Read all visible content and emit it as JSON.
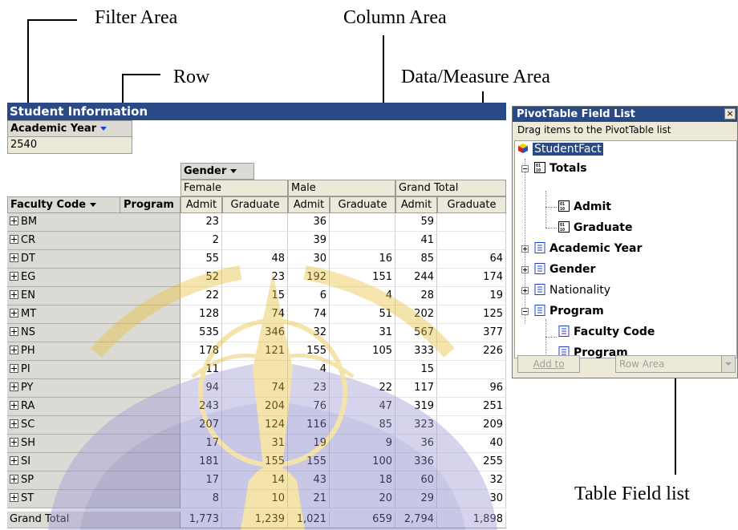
{
  "callouts": {
    "filter_area": "Filter Area",
    "column_area": "Column Area",
    "row": "Row",
    "data_measure_area": "Data/Measure Area",
    "table_field_list": "Table Field list"
  },
  "pivot": {
    "title": "Student Information",
    "filter_label": "Academic Year",
    "filter_value": "2540",
    "column_field": "Gender",
    "column_groups": [
      "Female",
      "Male",
      "Grand Total"
    ],
    "row_field": "Faculty Code",
    "row_field2": "Program",
    "measures": [
      "Admit",
      "Graduate"
    ],
    "rows": [
      {
        "code": "BM",
        "values": [
          "23",
          "",
          "36",
          "",
          "59",
          ""
        ]
      },
      {
        "code": "CR",
        "values": [
          "2",
          "",
          "39",
          "",
          "41",
          ""
        ]
      },
      {
        "code": "DT",
        "values": [
          "55",
          "48",
          "30",
          "16",
          "85",
          "64"
        ]
      },
      {
        "code": "EG",
        "values": [
          "52",
          "23",
          "192",
          "151",
          "244",
          "174"
        ]
      },
      {
        "code": "EN",
        "values": [
          "22",
          "15",
          "6",
          "4",
          "28",
          "19"
        ]
      },
      {
        "code": "MT",
        "values": [
          "128",
          "74",
          "74",
          "51",
          "202",
          "125"
        ]
      },
      {
        "code": "NS",
        "values": [
          "535",
          "346",
          "32",
          "31",
          "567",
          "377"
        ]
      },
      {
        "code": "PH",
        "values": [
          "178",
          "121",
          "155",
          "105",
          "333",
          "226"
        ]
      },
      {
        "code": "PI",
        "values": [
          "11",
          "",
          "4",
          "",
          "15",
          ""
        ]
      },
      {
        "code": "PY",
        "values": [
          "94",
          "74",
          "23",
          "22",
          "117",
          "96"
        ]
      },
      {
        "code": "RA",
        "values": [
          "243",
          "204",
          "76",
          "47",
          "319",
          "251"
        ]
      },
      {
        "code": "SC",
        "values": [
          "207",
          "124",
          "116",
          "85",
          "323",
          "209"
        ]
      },
      {
        "code": "SH",
        "values": [
          "17",
          "31",
          "19",
          "9",
          "36",
          "40"
        ]
      },
      {
        "code": "SI",
        "values": [
          "181",
          "155",
          "155",
          "100",
          "336",
          "255"
        ]
      },
      {
        "code": "SP",
        "values": [
          "17",
          "14",
          "43",
          "18",
          "60",
          "32"
        ]
      },
      {
        "code": "ST",
        "values": [
          "8",
          "10",
          "21",
          "20",
          "29",
          "30"
        ]
      }
    ],
    "grand_total_label": "Grand Total",
    "grand_total_values": [
      "1,773",
      "1,239",
      "1,021",
      "659",
      "2,794",
      "1,898"
    ]
  },
  "field_list": {
    "title": "PivotTable Field List",
    "hint": "Drag items to the PivotTable list",
    "close_glyph": "×",
    "root": "StudentFact",
    "totals": "Totals",
    "admit": "Admit",
    "graduate": "Graduate",
    "academic_year": "Academic Year",
    "gender": "Gender",
    "nationality": "Nationality",
    "program": "Program",
    "faculty_code": "Faculty Code",
    "program_child": "Program",
    "add_to_prefix": "Add to",
    "area_select": "Row Area"
  },
  "colors": {
    "title_bar": "#2a4a86",
    "header_gray": "#dcdad5",
    "watermark_purple": "#8b88c8",
    "watermark_gold": "#e7c13a"
  }
}
